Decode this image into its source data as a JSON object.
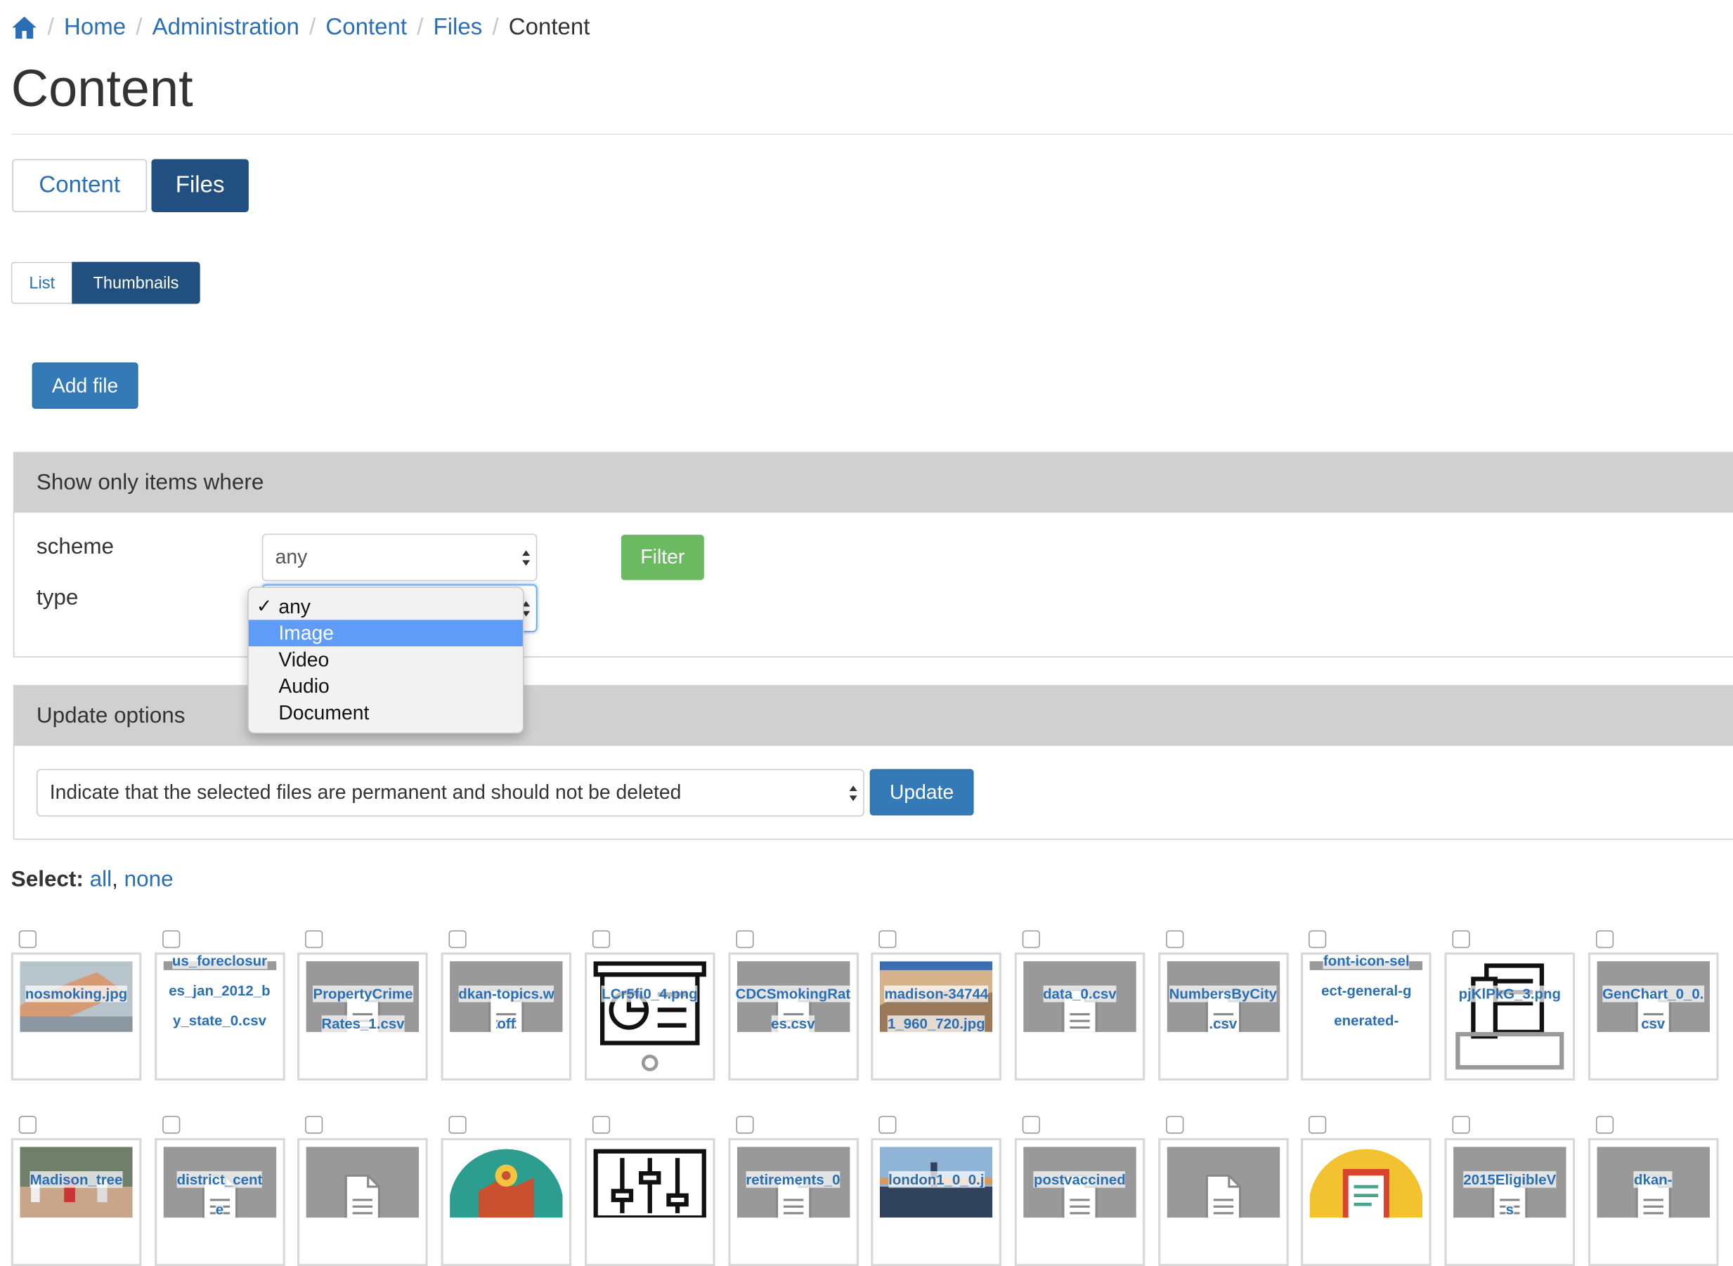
{
  "breadcrumb": {
    "items": [
      "Home",
      "Administration",
      "Content",
      "Files"
    ],
    "current": "Content"
  },
  "page_title": "Content",
  "tabs": {
    "content": "Content",
    "files": "Files"
  },
  "view_toggle": {
    "list": "List",
    "thumbnails": "Thumbnails"
  },
  "add_file": "Add file",
  "filter": {
    "heading": "Show only items where",
    "scheme_label": "scheme",
    "scheme_value": "any",
    "type_label": "type",
    "button": "Filter",
    "type_options": [
      "any",
      "Image",
      "Video",
      "Audio",
      "Document"
    ],
    "type_selected": "any",
    "type_highlighted": "Image"
  },
  "update": {
    "heading": "Update options",
    "operation": "Indicate that the selected files are permanent and should not be deleted",
    "button": "Update"
  },
  "select": {
    "label": "Select:",
    "all": "all",
    "sep": ",",
    "none": "none"
  },
  "colors": {
    "link": "#2a6fb5",
    "primary": "#337ab7",
    "dark_primary": "#214f80",
    "success": "#6bba62",
    "highlight": "#5f9cf8"
  },
  "files_row1": [
    {
      "name": "nosmoking.jpg",
      "preview": "photo-hand"
    },
    {
      "name": "us_foreclosures_jan_2012_by_state_0.csv",
      "preview": "none"
    },
    {
      "name": "PropertyCrimeRates_1.csv",
      "preview": "generic-doc"
    },
    {
      "name": "dkan-topics.woff",
      "preview": "generic-doc"
    },
    {
      "name": "LCr5fi0_4.png",
      "preview": "presentation-icon"
    },
    {
      "name": "CDCSmokingRates.csv",
      "preview": "generic-doc"
    },
    {
      "name": "madison-347441_960_720.jpg",
      "preview": "photo-city"
    },
    {
      "name": "data_0.csv",
      "preview": "generic-doc"
    },
    {
      "name": "NumbersByCity.csv",
      "preview": "generic-doc"
    },
    {
      "name": "font-icon-select-general-generated-",
      "preview": "none"
    },
    {
      "name": "pjKlPkG_3.png",
      "preview": "documents-icon"
    },
    {
      "name": "GenChart_0_0.csv",
      "preview": "generic-doc"
    }
  ],
  "files_row2": [
    {
      "name": "Madison_tree",
      "preview": "photo-crowd"
    },
    {
      "name": "district_cente",
      "preview": "generic-doc"
    },
    {
      "name": "",
      "preview": "generic-doc"
    },
    {
      "name": "",
      "preview": "map-pin-icon"
    },
    {
      "name": "",
      "preview": "sliders-icon"
    },
    {
      "name": "retirements_0",
      "preview": "generic-doc"
    },
    {
      "name": "london1_0_0.j",
      "preview": "photo-london"
    },
    {
      "name": "postvaccined",
      "preview": "generic-doc"
    },
    {
      "name": "",
      "preview": "generic-doc"
    },
    {
      "name": "",
      "preview": "clipboard-icon"
    },
    {
      "name": "2015EligibleVs",
      "preview": "generic-doc"
    },
    {
      "name": "dkan-",
      "preview": "generic-doc"
    }
  ]
}
